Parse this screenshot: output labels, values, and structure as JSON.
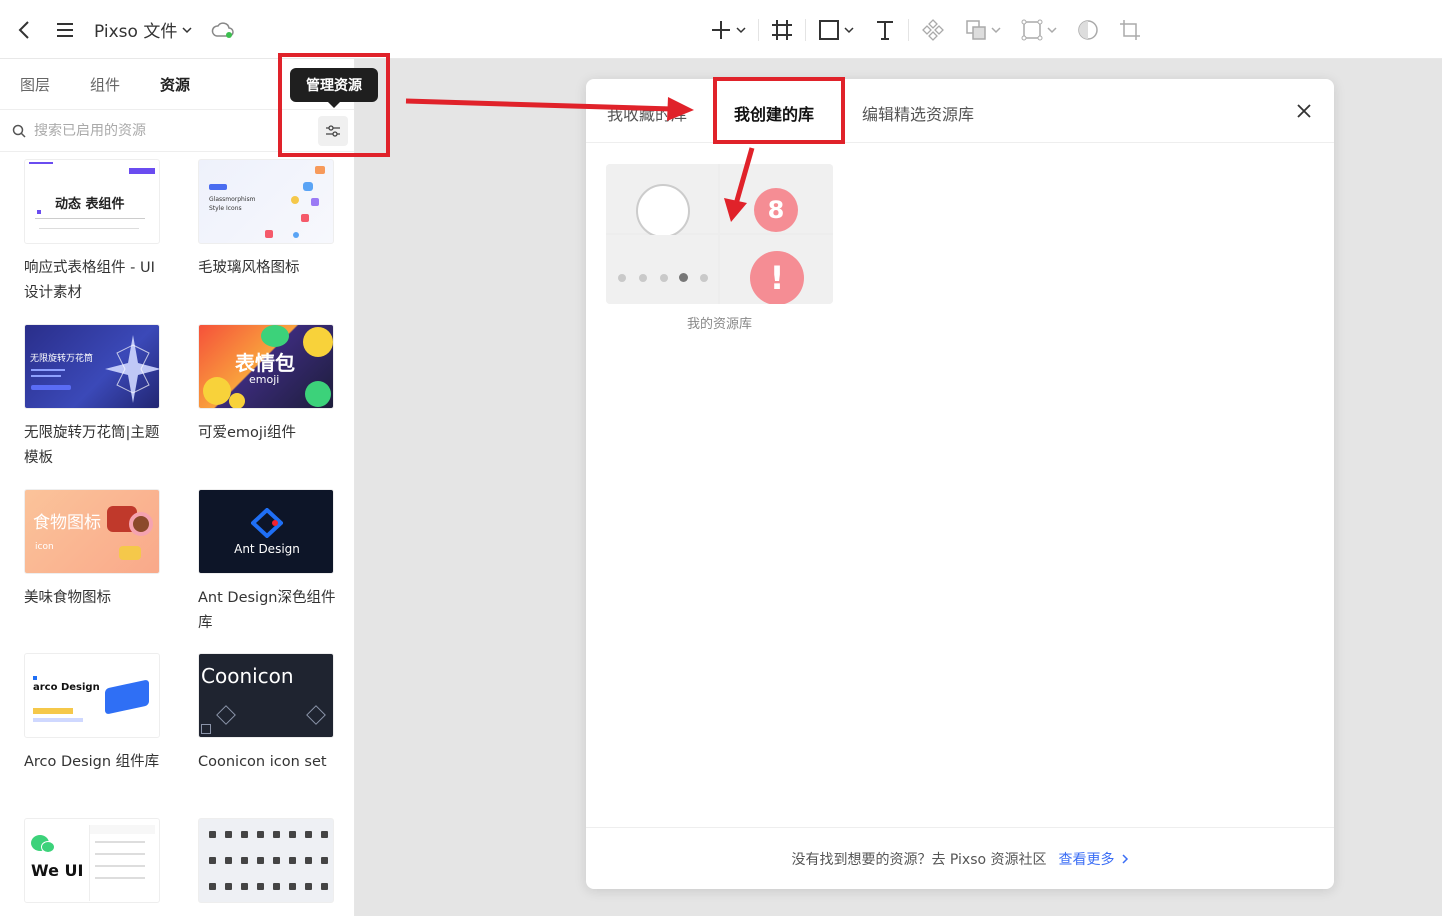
{
  "topbar": {
    "file_title": "Pixso 文件"
  },
  "left_panel": {
    "tabs": [
      "图层",
      "组件",
      "资源"
    ],
    "active_tab": 2,
    "search_placeholder": "搜索已启用的资源",
    "tooltip": "管理资源",
    "cards": [
      {
        "label": "响应式表格组件 - UI设计素材",
        "thumb_text": "动态 表组件"
      },
      {
        "label": "毛玻璃风格图标",
        "thumb_text": "Glassmorphism Style Icons"
      },
      {
        "label": "无限旋转万花筒|主题模板",
        "thumb_text": "无限旋转万花筒"
      },
      {
        "label": "可爱emoji组件",
        "thumb_text": "表情包",
        "thumb_sub": "emoji"
      },
      {
        "label": "美味食物图标",
        "thumb_text": "食物图标",
        "thumb_sub": "icon"
      },
      {
        "label": "Ant Design深色组件库",
        "thumb_text": "Ant Design"
      },
      {
        "label": "Arco Design 组件库",
        "thumb_text": "arco Design"
      },
      {
        "label": "Coonicon icon set",
        "thumb_text": "Coonicon"
      },
      {
        "label": "",
        "thumb_text": "We UI"
      },
      {
        "label": "",
        "thumb_text": ""
      }
    ]
  },
  "modal": {
    "tabs": [
      "我收藏的库",
      "我创建的库",
      "编辑精选资源库"
    ],
    "active_tab": 1,
    "library_name": "我的资源库",
    "badge_number": "8",
    "badge_alert": "!",
    "footer_text": "没有找到想要的资源？去 Pixso 资源社区",
    "footer_link": "查看更多"
  },
  "colors": {
    "highlight_red": "#e0222a",
    "link_blue": "#3b6ef5",
    "badge_pink": "#f58d94"
  }
}
